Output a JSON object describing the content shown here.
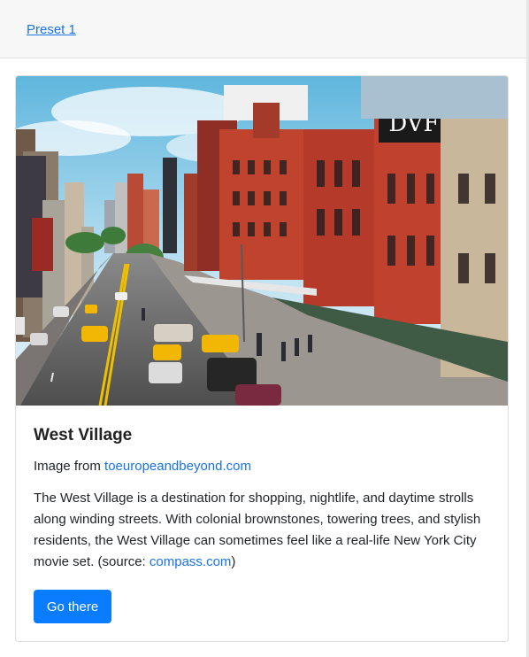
{
  "header": {
    "preset_link": "Preset 1"
  },
  "card": {
    "image_sign_text": "DVF",
    "title": "West Village",
    "credit": {
      "prefix": "Image from ",
      "link": "toeuropeandbeyond.com"
    },
    "description": {
      "text": "The West Village is a destination for shopping, nightlife, and daytime strolls along winding streets. With colonial brownstones, towering trees, and stylish residents, the West Village can sometimes feel like a real-life New York City movie set. (source: ",
      "link": "compass.com",
      "suffix": ")"
    },
    "button_label": "Go there"
  },
  "colors": {
    "link": "#1a73e8",
    "button": "#0a7cff"
  }
}
